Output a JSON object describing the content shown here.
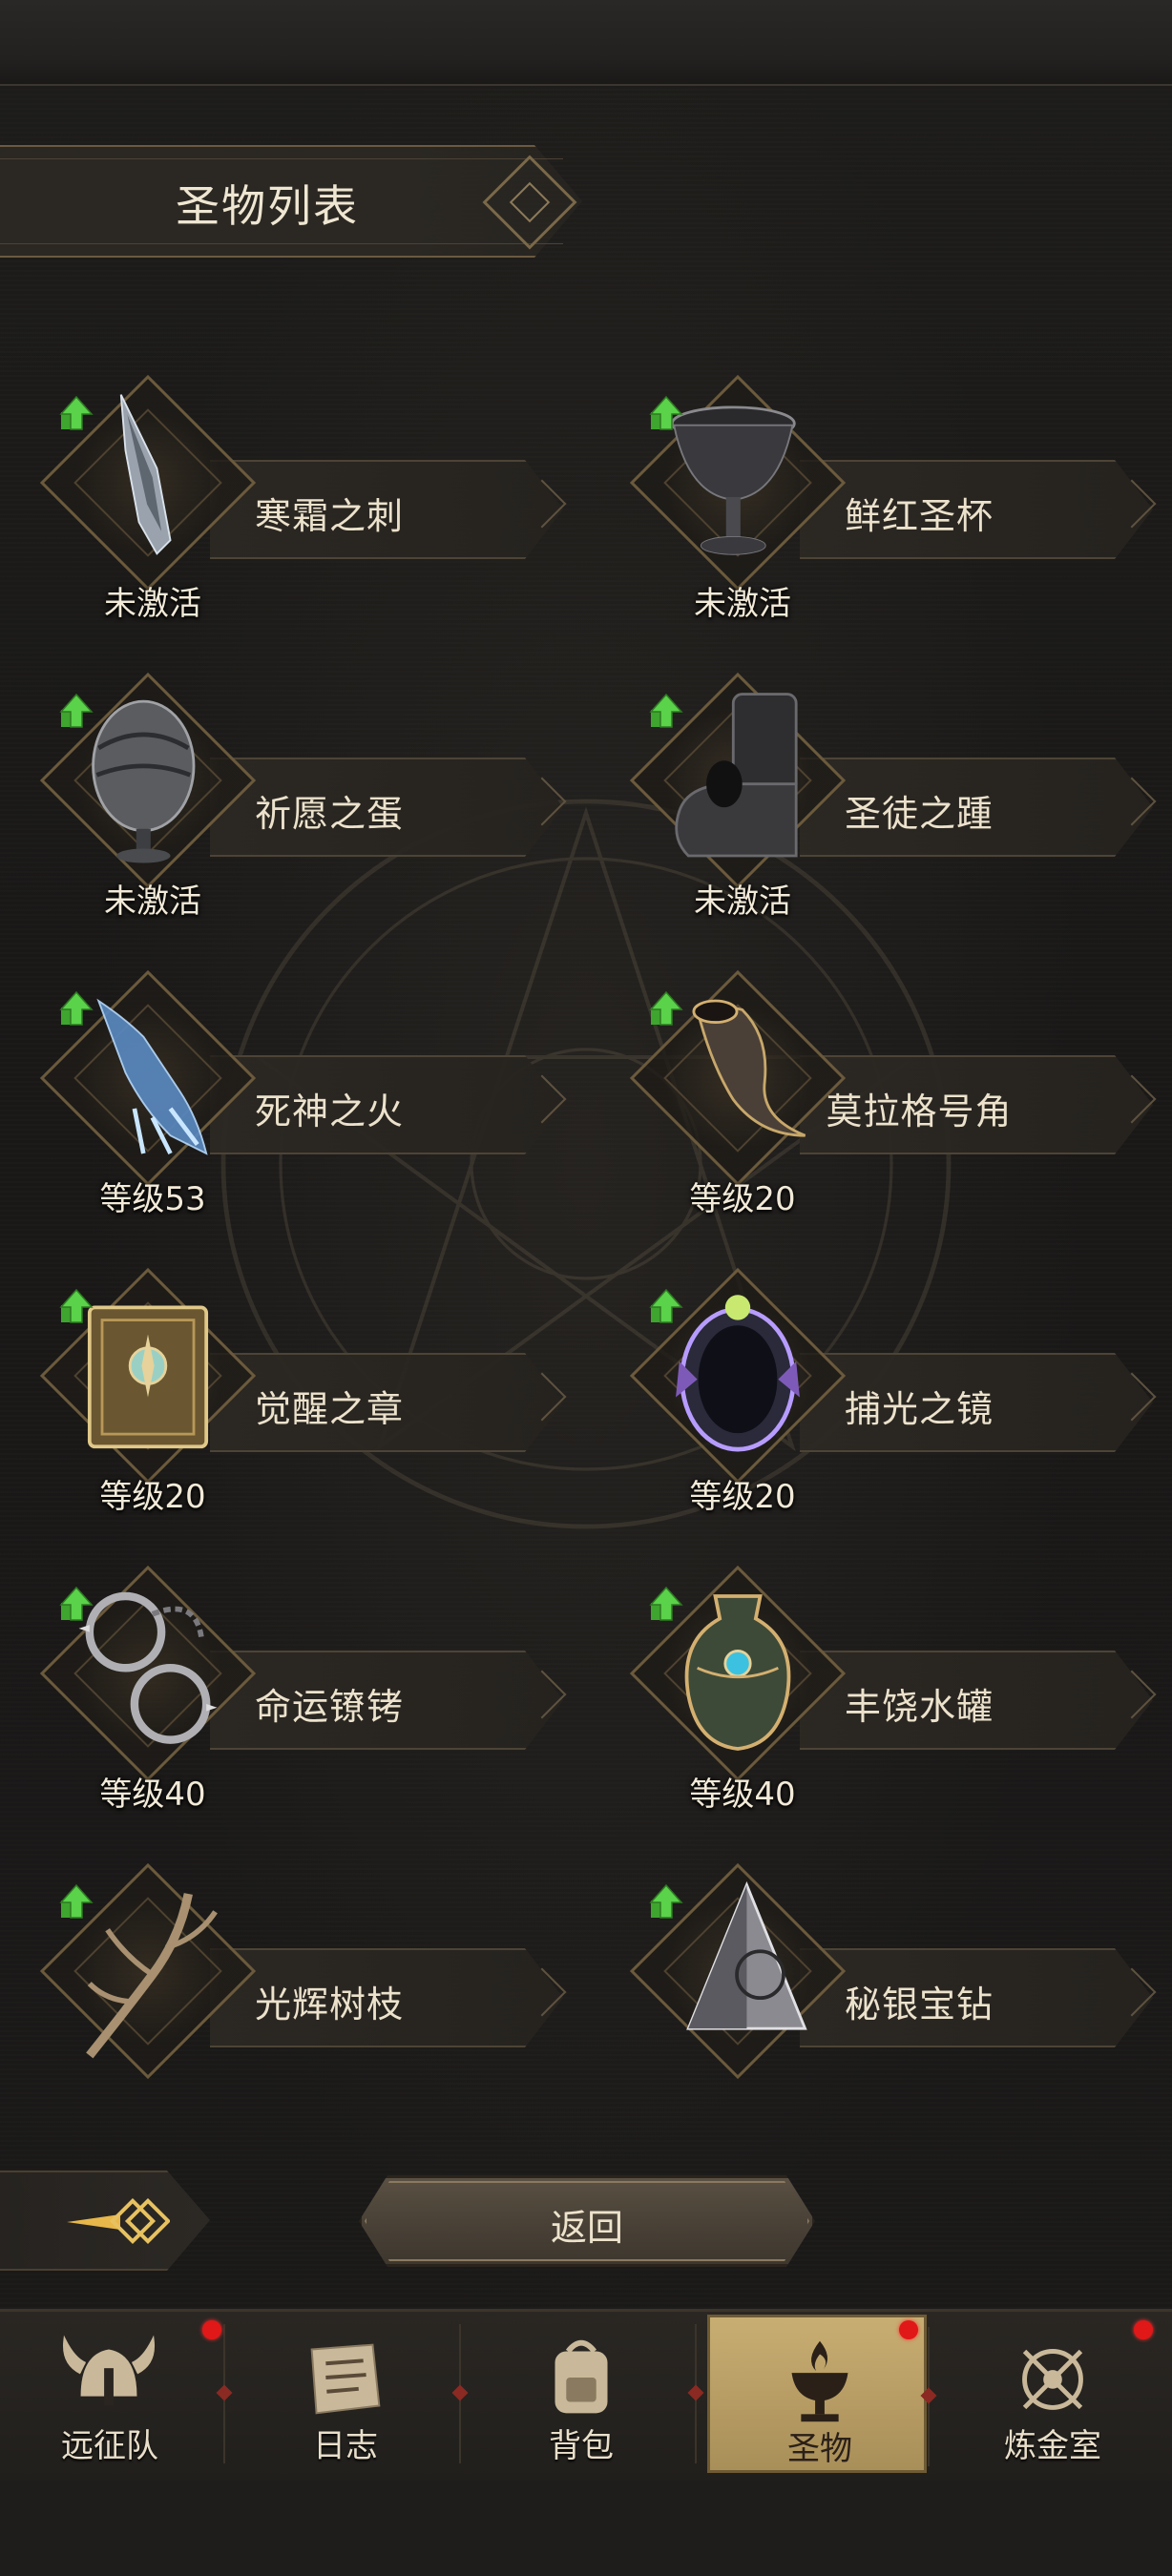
{
  "header": {
    "title": "圣物列表"
  },
  "relics": [
    {
      "name": "寒霜之刺",
      "status": "未激活",
      "icon": "frost-spike-icon"
    },
    {
      "name": "鲜红圣杯",
      "status": "未激活",
      "icon": "chalice-icon"
    },
    {
      "name": "祈愿之蛋",
      "status": "未激活",
      "icon": "egg-icon"
    },
    {
      "name": "圣徒之踵",
      "status": "未激活",
      "icon": "stone-foot-icon"
    },
    {
      "name": "死神之火",
      "status": "等级53",
      "icon": "spectral-hand-icon"
    },
    {
      "name": "莫拉格号角",
      "status": "等级20",
      "icon": "horn-icon"
    },
    {
      "name": "觉醒之章",
      "status": "等级20",
      "icon": "tome-icon"
    },
    {
      "name": "捕光之镜",
      "status": "等级20",
      "icon": "mirror-icon"
    },
    {
      "name": "命运镣铐",
      "status": "等级40",
      "icon": "shackles-icon"
    },
    {
      "name": "丰饶水罐",
      "status": "等级40",
      "icon": "jar-icon"
    },
    {
      "name": "光辉树枝",
      "status": "",
      "icon": "branch-icon"
    },
    {
      "name": "秘银宝钻",
      "status": "",
      "icon": "pyramid-gem-icon"
    }
  ],
  "back_button": {
    "label": "返回"
  },
  "nav": {
    "items": [
      {
        "label": "远征队",
        "icon": "viking-helmet-icon",
        "badge": true,
        "active": false
      },
      {
        "label": "日志",
        "icon": "scroll-icon",
        "badge": false,
        "active": false
      },
      {
        "label": "背包",
        "icon": "backpack-icon",
        "badge": false,
        "active": false
      },
      {
        "label": "圣物",
        "icon": "chalice-flame-icon",
        "badge": true,
        "active": true
      },
      {
        "label": "炼金室",
        "icon": "alchemy-icon",
        "badge": true,
        "active": false
      }
    ]
  },
  "colors": {
    "accent_gold": "#c8ae72",
    "badge_red": "#e01818",
    "upgrade_green": "#4cc23c"
  }
}
